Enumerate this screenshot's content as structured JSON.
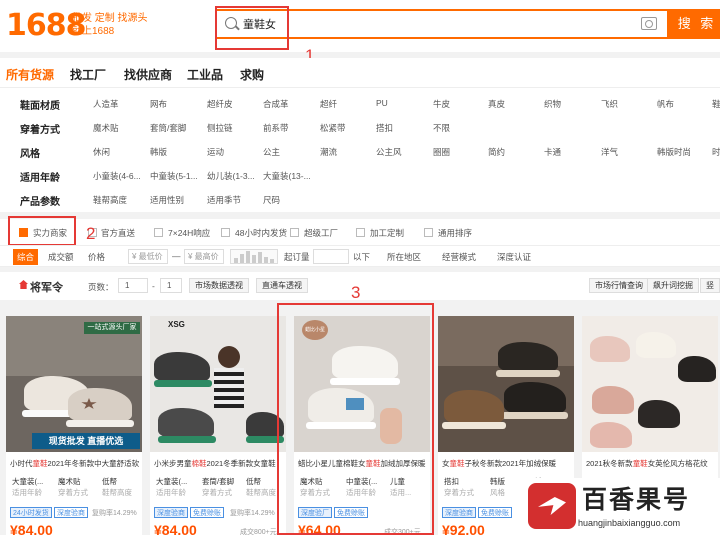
{
  "header": {
    "logo": "1688",
    "slogan_line1": "批发 定制 找源头",
    "slogan_line2": "就上1688",
    "search_value": "童鞋女",
    "search_button": "搜 索"
  },
  "annotations": [
    "1",
    "2",
    "3"
  ],
  "nav_tabs": [
    "所有货源",
    "找工厂",
    "找供应商",
    "工业品",
    "求购"
  ],
  "filters": {
    "material": {
      "label": "鞋面材质",
      "values": [
        "人造革",
        "网布",
        "超纤皮",
        "合成革",
        "超纤",
        "PU",
        "牛皮",
        "真皮",
        "织物",
        "飞织",
        "帆布",
        "鞋"
      ]
    },
    "wear": {
      "label": "穿着方式",
      "values": [
        "魔术贴",
        "套筒/套脚",
        "侧拉链",
        "前系带",
        "松紧带",
        "搭扣",
        "不限"
      ]
    },
    "style": {
      "label": "风格",
      "values": [
        "休闲",
        "韩版",
        "运动",
        "公主",
        "潮流",
        "公主风",
        "圈圈",
        "简约",
        "卡通",
        "洋气",
        "韩版时尚",
        "时"
      ]
    },
    "age": {
      "label": "适用年龄",
      "values": [
        "小童装(4-6...",
        "中童装(5-1...",
        "幼儿装(1-3...",
        "大童装(13-..."
      ]
    },
    "params": {
      "label": "产品参数",
      "values": [
        "鞋帮高度",
        "适用性别",
        "适用季节",
        "尺码"
      ]
    }
  },
  "checkboxes": [
    {
      "label": "实力商家",
      "checked": true
    },
    {
      "label": "官方直送",
      "checked": false
    },
    {
      "label": "7×24H响应",
      "checked": false
    },
    {
      "label": "48小时内发货",
      "checked": false
    },
    {
      "label": "超级工厂",
      "checked": false
    },
    {
      "label": "加工定制",
      "checked": false
    },
    {
      "label": "通用排序",
      "checked": false
    }
  ],
  "sortbar": {
    "active": "综合",
    "volume": "成交额",
    "price": "价格",
    "price_low": "¥ 最低价",
    "dash": "—",
    "price_high": "¥ 最高价",
    "min_order": "起订量",
    "below": "以下",
    "region": "所在地区",
    "business": "经营模式",
    "depth": "深度认证"
  },
  "general": {
    "title": "将军令",
    "page_label": "页数：",
    "page_current": "1",
    "page_sep": "-",
    "page_total": "1",
    "btn_market": "市场数据透视",
    "btn_direct": "直通车透视",
    "btn_market_view": "市场行情查询",
    "btn_keyword": "飙升词挖掘",
    "btn_more": "竖"
  },
  "products": [
    {
      "title_pre": "小时代",
      "title_hl": "童鞋",
      "title_post": "2021年冬新款中大童舒适软",
      "attrs": [
        [
          "大童装(...",
          "适用年龄"
        ],
        [
          "魔术贴",
          "穿着方式"
        ],
        [
          "低帮",
          "鞋帮高度"
        ]
      ],
      "tags": [
        "24小时发货",
        "深度验商"
      ],
      "rebuy": "复购率14.29%",
      "price": "¥84.00",
      "sold": "",
      "img_banner": "现货批发 直播优选",
      "img_badge": "一站式源头厂家"
    },
    {
      "title_pre": "小米步男童",
      "title_hl": "棉鞋",
      "title_post": "2021冬季新款女童鞋",
      "attrs": [
        [
          "大童装(...",
          "适用年龄"
        ],
        [
          "套筒/套脚",
          "穿着方式"
        ],
        [
          "低帮",
          "鞋帮高度"
        ]
      ],
      "tags": [
        "深度验商",
        "免费赊账"
      ],
      "rebuy": "复购率14.29%",
      "price": "¥84.00",
      "sold": "成交800+元",
      "img_banner": "",
      "img_badge": "XSG"
    },
    {
      "title_pre": "蜡比小星儿童棉鞋女",
      "title_hl": "童鞋",
      "title_post": "加绒加厚保暖",
      "attrs": [
        [
          "魔术贴",
          "穿着方式"
        ],
        [
          "中童装(...",
          "适用年龄"
        ],
        [
          "儿童",
          "适用..."
        ]
      ],
      "tags": [
        "深度验厂",
        "免费赊账"
      ],
      "rebuy": "",
      "price": "¥64.00",
      "sold": "成交300+元",
      "img_banner": "",
      "img_badge": "蜡比小星"
    },
    {
      "title_pre": "女",
      "title_hl": "童鞋",
      "title_post": "子秋冬新款2021年加绒保暖",
      "attrs": [
        [
          "搭扣",
          "穿着方式"
        ],
        [
          "韩版",
          "风格"
        ],
        [
          "低",
          ""
        ]
      ],
      "tags": [
        "深度验商",
        "免费赊账"
      ],
      "rebuy": "",
      "price": "¥92.00",
      "sold": "",
      "img_banner": "",
      "img_badge": ""
    },
    {
      "title_pre": "2021秋冬新款",
      "title_hl": "童鞋",
      "title_post": "女英伦风方格花纹",
      "attrs": [],
      "tags": [],
      "rebuy": "",
      "price": "",
      "sold": "",
      "img_banner": "",
      "img_badge": ""
    }
  ],
  "watermark": {
    "text": "百香果号",
    "url": "huangjinbaixiangguo.com"
  },
  "colors": {
    "brand": "#ff6a00",
    "annotation": "#e53935",
    "price": "#ff5000",
    "tag": "#4a90e2"
  }
}
